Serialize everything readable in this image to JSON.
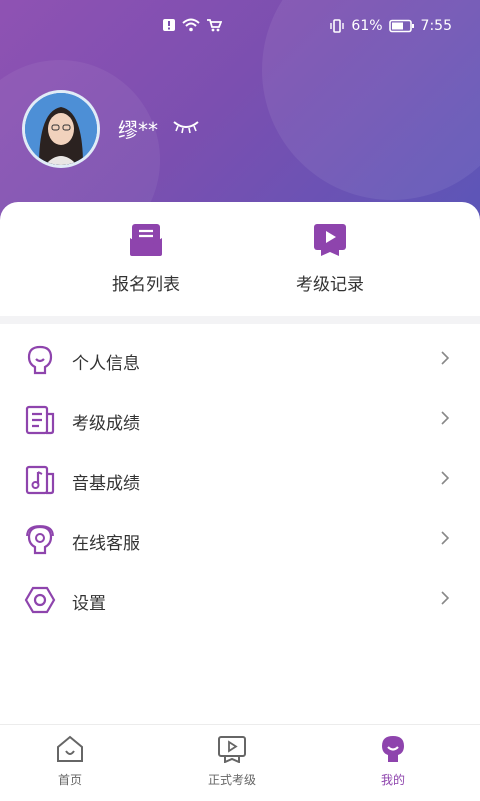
{
  "colors": {
    "accent": "#8e44ad",
    "header_start": "#8f52b3",
    "header_end": "#5a56b8"
  },
  "status": {
    "battery": "61%",
    "time": "7:55"
  },
  "profile": {
    "name": "缪**"
  },
  "quick_actions": [
    {
      "label": "报名列表",
      "icon": "envelope-list-icon"
    },
    {
      "label": "考级记录",
      "icon": "play-record-icon"
    }
  ],
  "menu": [
    {
      "label": "个人信息",
      "icon": "person-info-icon"
    },
    {
      "label": "考级成绩",
      "icon": "document-score-icon"
    },
    {
      "label": "音基成绩",
      "icon": "music-score-icon"
    },
    {
      "label": "在线客服",
      "icon": "headset-icon"
    },
    {
      "label": "设置",
      "icon": "settings-hexagon-icon"
    }
  ],
  "tabs": [
    {
      "label": "首页",
      "icon": "home-icon"
    },
    {
      "label": "正式考级",
      "icon": "play-record-icon"
    },
    {
      "label": "我的",
      "icon": "user-icon",
      "active": true
    }
  ]
}
